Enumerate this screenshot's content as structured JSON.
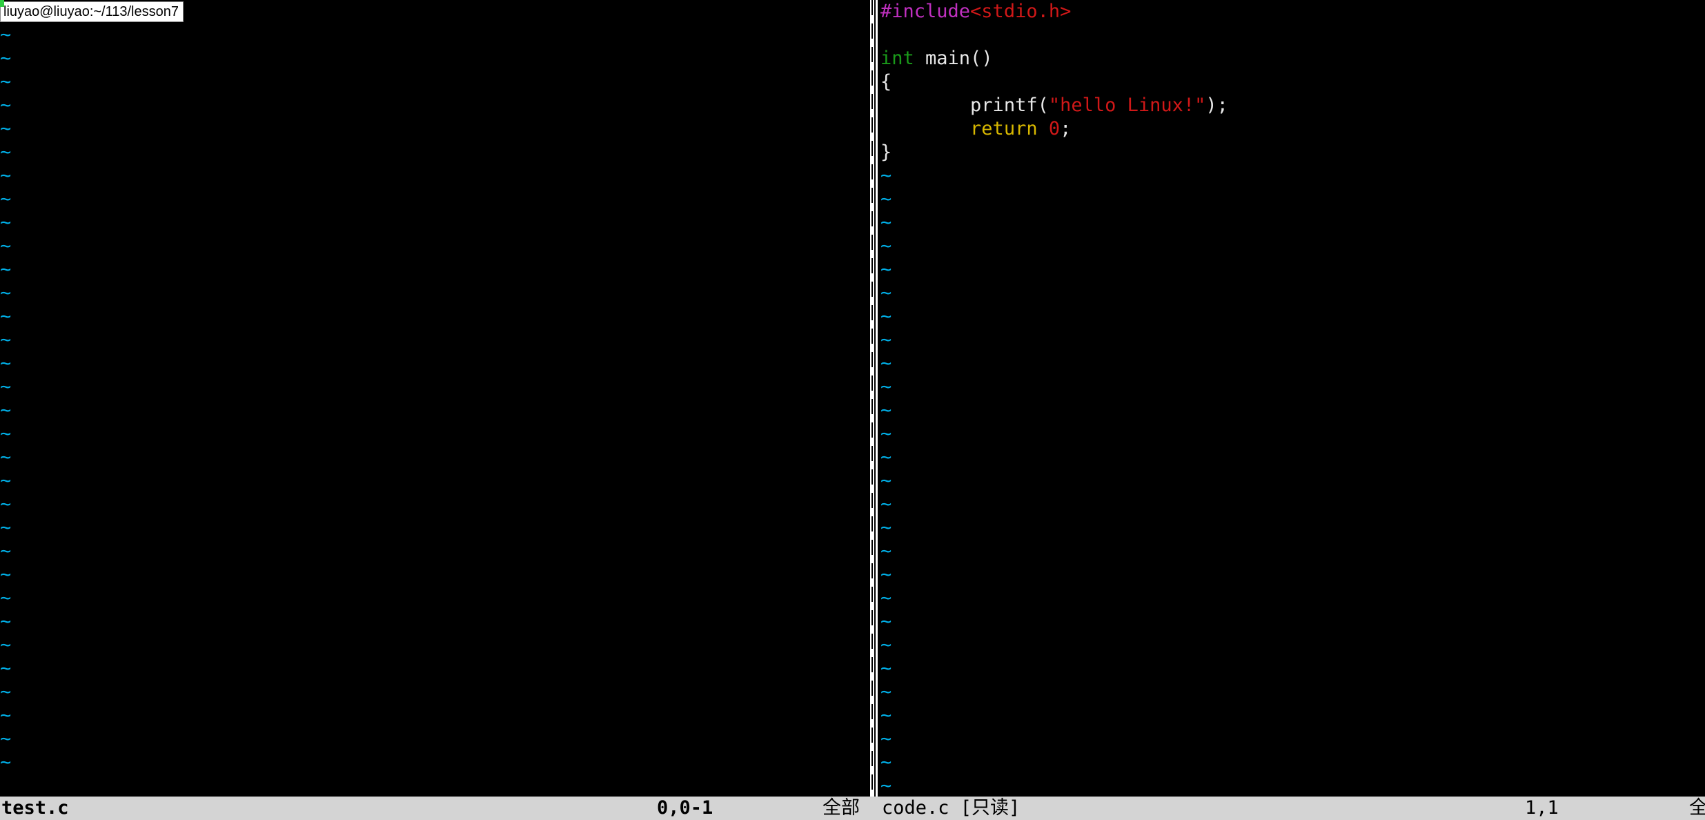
{
  "window": {
    "title": "liuyao@liuyao:~/113/lesson7"
  },
  "left_pane": {
    "file_name": "test.c",
    "position": "0,0-1",
    "scroll": "全部",
    "empty_marker": "~",
    "empty_line_count": 33
  },
  "right_pane": {
    "file_name": "code.c [只读]",
    "position": "1,1",
    "scroll": "全",
    "empty_marker": "~",
    "empty_line_count": 27,
    "code": {
      "line1_directive": "#include",
      "line1_header": "<stdio.h>",
      "line3_type": "int",
      "line3_rest": " main()",
      "line4": "{",
      "line5_indent": "        ",
      "line5_call": "printf(",
      "line5_string": "\"hello Linux!\"",
      "line5_end": ");",
      "line6_indent": "        ",
      "line6_keyword": "return",
      "line6_space": " ",
      "line6_number": "0",
      "line6_end": ";",
      "line7": "}"
    }
  },
  "colors": {
    "background": "#000000",
    "tilde": "#00b0e8",
    "preprocessor": "#c030c0",
    "string": "#d01818",
    "type": "#1a9a1a",
    "keyword": "#d8b800",
    "statusline": "#d4d4d4"
  }
}
